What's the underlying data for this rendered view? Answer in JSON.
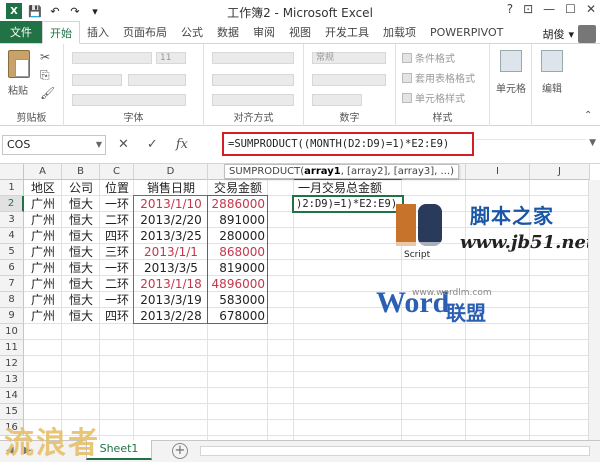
{
  "window": {
    "title": "工作簿2 - Microsoft Excel",
    "controls": [
      "?",
      "⊡",
      "—",
      "☐",
      "✕"
    ]
  },
  "ribbon_tabs": {
    "file": "文件",
    "items": [
      "开始",
      "插入",
      "页面布局",
      "公式",
      "数据",
      "审阅",
      "视图",
      "开发工具",
      "加载项",
      "POWERPIVOT"
    ],
    "active": "开始",
    "user": "胡俊"
  },
  "ribbon": {
    "clipboard": {
      "paste": "粘贴",
      "label": "剪贴板"
    },
    "font": {
      "size": "11",
      "label": "字体"
    },
    "alignment": {
      "label": "对齐方式"
    },
    "number": {
      "format": "常规",
      "label": "数字"
    },
    "styles": {
      "items": [
        "条件格式",
        "套用表格格式",
        "单元格样式"
      ],
      "label": "样式"
    },
    "cells": {
      "label": "单元格"
    },
    "editing": {
      "label": "编辑"
    }
  },
  "formula_bar": {
    "name_box": "COS",
    "formula": "=SUMPRODUCT((MONTH(D2:D9)=1)*E2:E9)",
    "tooltip_prefix": "SUMPRODUCT(",
    "tooltip_arg1": "array1",
    "tooltip_rest": ", [array2], [array3], ...)"
  },
  "grid": {
    "columns": [
      "A",
      "B",
      "C",
      "D",
      "E",
      "F",
      "G",
      "H",
      "I",
      "J"
    ],
    "rows": [
      "1",
      "2",
      "3",
      "4",
      "5",
      "6",
      "7",
      "8",
      "9",
      "10",
      "11",
      "12",
      "13",
      "14",
      "15",
      "16"
    ],
    "headers": [
      "地区",
      "公司",
      "位置",
      "销售日期",
      "交易金额"
    ],
    "g1_header": "一月交易总金额",
    "active_cell_text": ")2:D9)=1)*E2:E9)",
    "data": [
      [
        "广州",
        "恒大",
        "一环",
        "2013/1/10",
        "2886000"
      ],
      [
        "广州",
        "恒大",
        "二环",
        "2013/2/20",
        "891000"
      ],
      [
        "广州",
        "恒大",
        "四环",
        "2013/3/25",
        "280000"
      ],
      [
        "广州",
        "恒大",
        "三环",
        "2013/1/1",
        "868000"
      ],
      [
        "广州",
        "恒大",
        "一环",
        "2013/3/5",
        "819000"
      ],
      [
        "广州",
        "恒大",
        "二环",
        "2013/1/18",
        "4896000"
      ],
      [
        "广州",
        "恒大",
        "一环",
        "2013/3/19",
        "583000"
      ],
      [
        "广州",
        "恒大",
        "四环",
        "2013/2/28",
        "678000"
      ]
    ],
    "red_rows": [
      0,
      3,
      5
    ]
  },
  "watermarks": {
    "jb_cn": "脚本之家",
    "jb_url": "www.jb51.net",
    "script": "Script",
    "word_logo": "Word",
    "word_cn": "联盟",
    "word_url": "www.wordlm.com",
    "liulang": "流浪者"
  },
  "sheets": {
    "tabs": [
      "Sheet1"
    ],
    "add": "+"
  }
}
